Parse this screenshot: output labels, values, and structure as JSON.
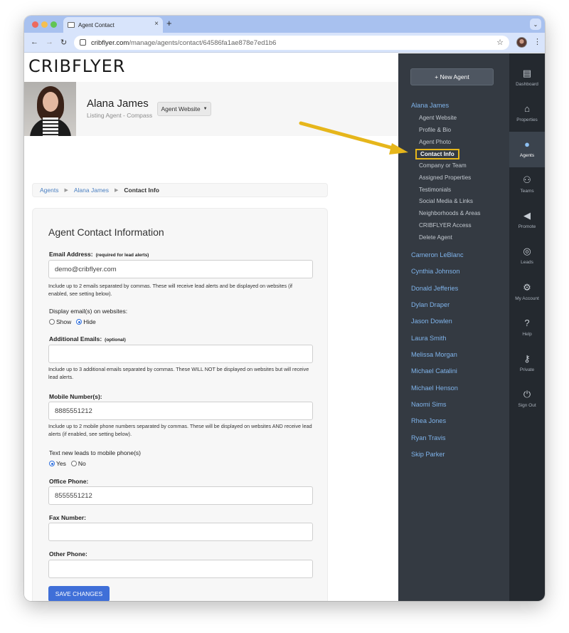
{
  "browser": {
    "tab_title": "Agent Contact",
    "tab_close": "×",
    "new_tab": "+",
    "url_host": "cribflyer.com",
    "url_path": "/manage/agents/contact/64586fa1ae878e7ed1b6"
  },
  "brand": {
    "logo": "CRIBFLYER"
  },
  "agent": {
    "name": "Alana James",
    "subtitle": "Listing Agent - Compass",
    "website_button": "Agent Website"
  },
  "breadcrumb": {
    "items": [
      "Agents",
      "Alana James"
    ],
    "current": "Contact Info"
  },
  "form": {
    "title": "Agent Contact Information",
    "email_label": "Email Address:",
    "email_note": "(required for lead alerts)",
    "email_value": "demo@cribflyer.com",
    "email_help": "Include up to 2 emails separated by commas. These will receive lead alerts and be displayed on websites (if enabled, see setting below).",
    "display_label": "Display email(s) on websites:",
    "display_options": [
      "Show",
      "Hide"
    ],
    "display_selected": "Hide",
    "additional_label": "Additional Emails:",
    "additional_note": "(optional)",
    "additional_value": "",
    "additional_help": "Include up to 3 additional emails separated by commas. These WILL NOT be displayed on websites but will receive lead alerts.",
    "mobile_label": "Mobile Number(s):",
    "mobile_value": "8885551212",
    "mobile_help": "Include up to 2 mobile phone numbers separated by commas. These will be displayed on websites AND receive lead alerts (if enabled, see setting below).",
    "text_label": "Text new leads to mobile phone(s)",
    "text_options": [
      "Yes",
      "No"
    ],
    "text_selected": "Yes",
    "office_label": "Office Phone:",
    "office_value": "8555551212",
    "fax_label": "Fax Number:",
    "fax_value": "",
    "other_label": "Other Phone:",
    "other_value": "",
    "save_label": "SAVE CHANGES"
  },
  "sidebar": {
    "new_agent": "+ New Agent",
    "current_agent": "Alana James",
    "sub_items": [
      "Agent Website",
      "Profile & Bio",
      "Agent Photo",
      "Contact Info",
      "Company or Team",
      "Assigned Properties",
      "Testimonials",
      "Social Media & Links",
      "Neighborhoods & Areas",
      "CRIBFLYER Access",
      "Delete Agent"
    ],
    "active_sub": "Contact Info",
    "agents": [
      "Cameron LeBlanc",
      "Cynthia Johnson",
      "Donald Jefferies",
      "Dylan Draper",
      "Jason Dowlen",
      "Laura Smith",
      "Melissa Morgan",
      "Michael Catalini",
      "Michael Henson",
      "Naomi Sims",
      "Rhea Jones",
      "Ryan Travis",
      "Skip Parker"
    ]
  },
  "rail": [
    {
      "label": "Dashboard",
      "icon": "dashboard-icon"
    },
    {
      "label": "Properties",
      "icon": "properties-icon"
    },
    {
      "label": "Agents",
      "icon": "agents-icon"
    },
    {
      "label": "Teams",
      "icon": "teams-icon"
    },
    {
      "label": "Promote",
      "icon": "megaphone-icon"
    },
    {
      "label": "Leads",
      "icon": "target-icon"
    },
    {
      "label": "My Account",
      "icon": "gear-icon"
    },
    {
      "label": "Help",
      "icon": "help-icon"
    },
    {
      "label": "Private",
      "icon": "key-icon"
    },
    {
      "label": "Sign Out",
      "icon": "power-icon"
    }
  ],
  "colors": {
    "sidebar_bg": "#343a42",
    "rail_bg": "#24292f",
    "link": "#7fb3ea",
    "highlight": "#e6b61b",
    "primary_button": "#3f6fd8"
  }
}
